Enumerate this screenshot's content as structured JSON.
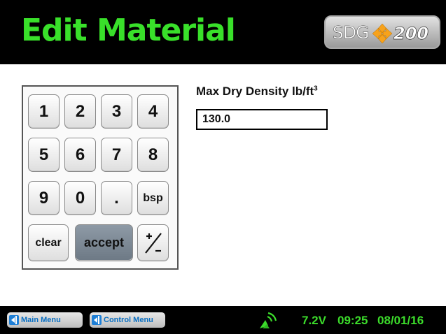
{
  "header": {
    "title": "Edit Material",
    "logo": {
      "sdg": "SDG",
      "model": "200",
      "icon": "orange-arrows-icon"
    }
  },
  "keypad": {
    "keys": [
      "1",
      "2",
      "3",
      "4",
      "5",
      "6",
      "7",
      "8",
      "9",
      "0",
      ".",
      "bsp",
      "clear",
      "accept",
      "+/-"
    ]
  },
  "field": {
    "label": "Max Dry Density lb/ft",
    "label_superscript": "3",
    "value": "130.0"
  },
  "footer": {
    "main_menu_label": "Main Menu",
    "control_menu_label": "Control Menu",
    "voltage": "7.2V",
    "time": "09:25",
    "date": "08/01/16",
    "signal_icon": "satellite-signal-icon"
  },
  "colors": {
    "title_green": "#39e02a",
    "status_green": "#3cdc2b",
    "accept_key": "#7a8692",
    "menu_blue": "#1e7fd6"
  }
}
